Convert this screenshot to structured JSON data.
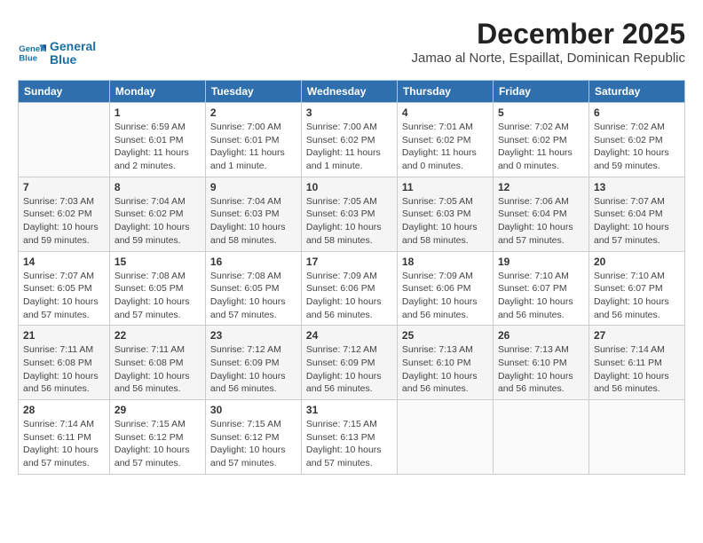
{
  "header": {
    "logo_line1": "General",
    "logo_line2": "Blue",
    "title": "December 2025",
    "location": "Jamao al Norte, Espaillat, Dominican Republic"
  },
  "days_of_week": [
    "Sunday",
    "Monday",
    "Tuesday",
    "Wednesday",
    "Thursday",
    "Friday",
    "Saturday"
  ],
  "weeks": [
    [
      {
        "day": "",
        "info": ""
      },
      {
        "day": "1",
        "info": "Sunrise: 6:59 AM\nSunset: 6:01 PM\nDaylight: 11 hours\nand 2 minutes."
      },
      {
        "day": "2",
        "info": "Sunrise: 7:00 AM\nSunset: 6:01 PM\nDaylight: 11 hours\nand 1 minute."
      },
      {
        "day": "3",
        "info": "Sunrise: 7:00 AM\nSunset: 6:02 PM\nDaylight: 11 hours\nand 1 minute."
      },
      {
        "day": "4",
        "info": "Sunrise: 7:01 AM\nSunset: 6:02 PM\nDaylight: 11 hours\nand 0 minutes."
      },
      {
        "day": "5",
        "info": "Sunrise: 7:02 AM\nSunset: 6:02 PM\nDaylight: 11 hours\nand 0 minutes."
      },
      {
        "day": "6",
        "info": "Sunrise: 7:02 AM\nSunset: 6:02 PM\nDaylight: 10 hours\nand 59 minutes."
      }
    ],
    [
      {
        "day": "7",
        "info": "Sunrise: 7:03 AM\nSunset: 6:02 PM\nDaylight: 10 hours\nand 59 minutes."
      },
      {
        "day": "8",
        "info": "Sunrise: 7:04 AM\nSunset: 6:02 PM\nDaylight: 10 hours\nand 59 minutes."
      },
      {
        "day": "9",
        "info": "Sunrise: 7:04 AM\nSunset: 6:03 PM\nDaylight: 10 hours\nand 58 minutes."
      },
      {
        "day": "10",
        "info": "Sunrise: 7:05 AM\nSunset: 6:03 PM\nDaylight: 10 hours\nand 58 minutes."
      },
      {
        "day": "11",
        "info": "Sunrise: 7:05 AM\nSunset: 6:03 PM\nDaylight: 10 hours\nand 58 minutes."
      },
      {
        "day": "12",
        "info": "Sunrise: 7:06 AM\nSunset: 6:04 PM\nDaylight: 10 hours\nand 57 minutes."
      },
      {
        "day": "13",
        "info": "Sunrise: 7:07 AM\nSunset: 6:04 PM\nDaylight: 10 hours\nand 57 minutes."
      }
    ],
    [
      {
        "day": "14",
        "info": "Sunrise: 7:07 AM\nSunset: 6:05 PM\nDaylight: 10 hours\nand 57 minutes."
      },
      {
        "day": "15",
        "info": "Sunrise: 7:08 AM\nSunset: 6:05 PM\nDaylight: 10 hours\nand 57 minutes."
      },
      {
        "day": "16",
        "info": "Sunrise: 7:08 AM\nSunset: 6:05 PM\nDaylight: 10 hours\nand 57 minutes."
      },
      {
        "day": "17",
        "info": "Sunrise: 7:09 AM\nSunset: 6:06 PM\nDaylight: 10 hours\nand 56 minutes."
      },
      {
        "day": "18",
        "info": "Sunrise: 7:09 AM\nSunset: 6:06 PM\nDaylight: 10 hours\nand 56 minutes."
      },
      {
        "day": "19",
        "info": "Sunrise: 7:10 AM\nSunset: 6:07 PM\nDaylight: 10 hours\nand 56 minutes."
      },
      {
        "day": "20",
        "info": "Sunrise: 7:10 AM\nSunset: 6:07 PM\nDaylight: 10 hours\nand 56 minutes."
      }
    ],
    [
      {
        "day": "21",
        "info": "Sunrise: 7:11 AM\nSunset: 6:08 PM\nDaylight: 10 hours\nand 56 minutes."
      },
      {
        "day": "22",
        "info": "Sunrise: 7:11 AM\nSunset: 6:08 PM\nDaylight: 10 hours\nand 56 minutes."
      },
      {
        "day": "23",
        "info": "Sunrise: 7:12 AM\nSunset: 6:09 PM\nDaylight: 10 hours\nand 56 minutes."
      },
      {
        "day": "24",
        "info": "Sunrise: 7:12 AM\nSunset: 6:09 PM\nDaylight: 10 hours\nand 56 minutes."
      },
      {
        "day": "25",
        "info": "Sunrise: 7:13 AM\nSunset: 6:10 PM\nDaylight: 10 hours\nand 56 minutes."
      },
      {
        "day": "26",
        "info": "Sunrise: 7:13 AM\nSunset: 6:10 PM\nDaylight: 10 hours\nand 56 minutes."
      },
      {
        "day": "27",
        "info": "Sunrise: 7:14 AM\nSunset: 6:11 PM\nDaylight: 10 hours\nand 56 minutes."
      }
    ],
    [
      {
        "day": "28",
        "info": "Sunrise: 7:14 AM\nSunset: 6:11 PM\nDaylight: 10 hours\nand 57 minutes."
      },
      {
        "day": "29",
        "info": "Sunrise: 7:15 AM\nSunset: 6:12 PM\nDaylight: 10 hours\nand 57 minutes."
      },
      {
        "day": "30",
        "info": "Sunrise: 7:15 AM\nSunset: 6:12 PM\nDaylight: 10 hours\nand 57 minutes."
      },
      {
        "day": "31",
        "info": "Sunrise: 7:15 AM\nSunset: 6:13 PM\nDaylight: 10 hours\nand 57 minutes."
      },
      {
        "day": "",
        "info": ""
      },
      {
        "day": "",
        "info": ""
      },
      {
        "day": "",
        "info": ""
      }
    ]
  ]
}
